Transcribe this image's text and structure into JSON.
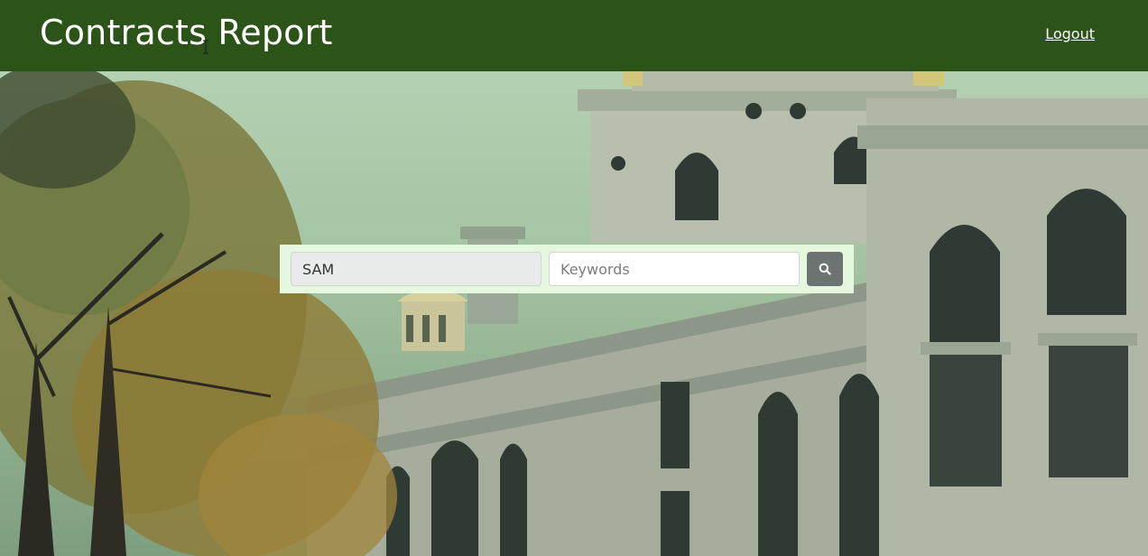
{
  "header": {
    "title": "Contracts Report",
    "logout_label": "Logout"
  },
  "search": {
    "source_value": "SAM",
    "keywords_placeholder": "Keywords",
    "keywords_value": "",
    "button_icon": "search-icon"
  },
  "colors": {
    "header_bg": "#2c5418",
    "panel_bg": "#e6f7df",
    "button_bg": "#6c7371"
  }
}
